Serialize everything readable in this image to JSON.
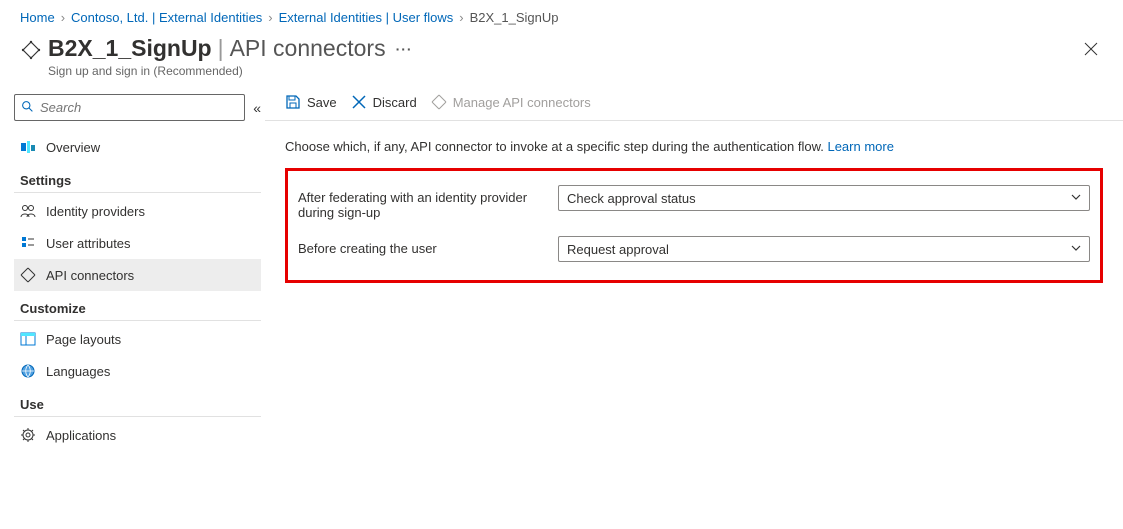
{
  "breadcrumb": [
    {
      "label": "Home",
      "current": false
    },
    {
      "label": "Contoso, Ltd. | External Identities",
      "current": false
    },
    {
      "label": "External Identities | User flows",
      "current": false
    },
    {
      "label": "B2X_1_SignUp",
      "current": true
    }
  ],
  "header": {
    "title_main": "B2X_1_SignUp",
    "title_sub": "API connectors",
    "subtitle_small": "Sign up and sign in (Recommended)"
  },
  "sidebar": {
    "search_placeholder": "Search",
    "item_overview": "Overview",
    "heading_settings": "Settings",
    "item_identity_providers": "Identity providers",
    "item_user_attributes": "User attributes",
    "item_api_connectors": "API connectors",
    "heading_customize": "Customize",
    "item_page_layouts": "Page layouts",
    "item_languages": "Languages",
    "heading_use": "Use",
    "item_applications": "Applications"
  },
  "toolbar": {
    "save_label": "Save",
    "discard_label": "Discard",
    "manage_label": "Manage API connectors"
  },
  "content": {
    "info_text": "Choose which, if any, API connector to invoke at a specific step during the authentication flow. ",
    "learn_more": "Learn more",
    "rows": [
      {
        "label": "After federating with an identity provider during sign-up",
        "value": "Check approval status"
      },
      {
        "label": "Before creating the user",
        "value": "Request approval"
      }
    ]
  }
}
